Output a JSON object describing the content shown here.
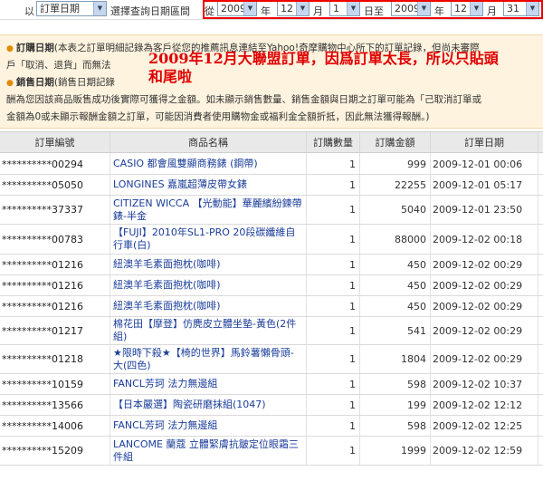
{
  "filter": {
    "prefix": "以",
    "type_select": "訂單日期",
    "select_hint": "選擇查詢日期區間",
    "from_char": "從",
    "from_year": "2009",
    "year_unit": "年",
    "from_month": "12",
    "month_unit": "月",
    "from_day": "1",
    "day_unit": "日至",
    "to_year": "2009",
    "to_year_unit": "年",
    "to_month": "12",
    "to_month_unit": "月",
    "to_day": "31"
  },
  "notice": {
    "line1_label": "訂購日期",
    "line1_text": "(本表之訂單明細記錄為客戶從您的推薦訊息連結至Yahoo!奇摩購物中心所下的訂單記錄，但尚未審際",
    "line2_text": "戶「取消、退貨」而無法",
    "line3_label": "銷售日期",
    "line3_text": "(銷售日期記錄",
    "line4_text": "酬為您因該商品販售成功後實際可獲得之金額。如未顯示銷售數量、銷售金額與日期之訂單可能為「己取消訂單或",
    "line5_text": "金額為0或未顯示報酬金額之訂單，可能因消費者使用購物金或福利金全額折抵，因此無法獲得報酬。)",
    "overlay_line1": "2009年12月大聯盟訂單，因爲訂單太長，所以只貼頭",
    "overlay_line2": "和尾啦"
  },
  "table": {
    "headers": [
      "訂單編號",
      "商品名稱",
      "訂購數量",
      "訂購金額",
      "訂單日期"
    ],
    "rows": [
      {
        "id": "**********00294",
        "name": "CASIO 都會風雙顯商務錶 (鋼帶)",
        "qty": "1",
        "amount": "999",
        "date": "2009-12-01 00:06"
      },
      {
        "id": "**********05050",
        "name": "LONGINES 嘉嵐超薄皮帶女錶",
        "qty": "1",
        "amount": "22255",
        "date": "2009-12-01 05:17"
      },
      {
        "id": "**********37337",
        "name": "CITIZEN WICCA 【光動能】華麗繽紛鍊帶錶-半金",
        "qty": "1",
        "amount": "5040",
        "date": "2009-12-01 23:50"
      },
      {
        "id": "**********00783",
        "name": "【FUJI】2010年SL1-PRO 20段碳纖維自行車(白)",
        "qty": "1",
        "amount": "88000",
        "date": "2009-12-02 00:18"
      },
      {
        "id": "**********01216",
        "name": "紐澳羊毛素面抱枕(咖啡)",
        "qty": "1",
        "amount": "450",
        "date": "2009-12-02 00:29"
      },
      {
        "id": "**********01216",
        "name": "紐澳羊毛素面抱枕(咖啡)",
        "qty": "1",
        "amount": "450",
        "date": "2009-12-02 00:29"
      },
      {
        "id": "**********01216",
        "name": "紐澳羊毛素面抱枕(咖啡)",
        "qty": "1",
        "amount": "450",
        "date": "2009-12-02 00:29"
      },
      {
        "id": "**********01217",
        "name": "棉花田【摩登】仿麂皮立體坐墊-黃色(2件組)",
        "qty": "1",
        "amount": "541",
        "date": "2009-12-02 00:29"
      },
      {
        "id": "**********01218",
        "name": "★限時下殺★【椅的世界】馬鈴薯懶骨頭-大(四色)",
        "qty": "1",
        "amount": "1804",
        "date": "2009-12-02 00:29"
      },
      {
        "id": "**********10159",
        "name": "FANCL芳珂 法力無邊組",
        "qty": "1",
        "amount": "598",
        "date": "2009-12-02 10:37"
      },
      {
        "id": "**********13566",
        "name": "【日本嚴選】陶瓷研磨抹組(1047)",
        "qty": "1",
        "amount": "199",
        "date": "2009-12-02 12:12"
      },
      {
        "id": "**********14006",
        "name": "FANCL芳珂 法力無邊組",
        "qty": "1",
        "amount": "598",
        "date": "2009-12-02 12:25"
      },
      {
        "id": "**********15209",
        "name": "LANCOME 蘭蔻 立體緊膚抗皺定位眼霜三件組",
        "qty": "1",
        "amount": "1999",
        "date": "2009-12-02 12:59"
      }
    ]
  }
}
